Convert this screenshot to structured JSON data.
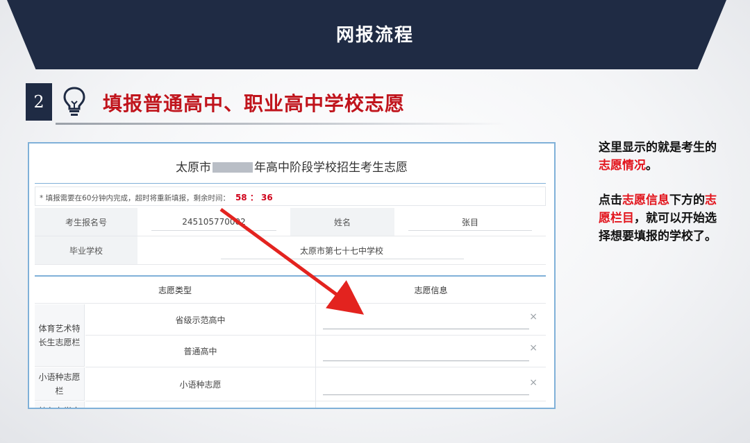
{
  "banner": {
    "title": "网报流程"
  },
  "step": {
    "number": "2",
    "icon": "lightbulb-icon",
    "title": "填报普通高中、职业高中学校志愿"
  },
  "form": {
    "title_prefix": "太原市",
    "title_suffix": "年高中阶段学校招生考生志愿",
    "notice": "* 填报需要在60分钟内完成，超时将重新填报，剩余时间：",
    "timer": "58 ： 36",
    "info": {
      "exam_no_label": "考生报名号",
      "exam_no_value": "245105770002",
      "name_label": "姓名",
      "name_value": "张目",
      "school_label": "毕业学校",
      "school_value": "太原市第七十七中学校"
    },
    "volunteer_table": {
      "header_type": "志愿类型",
      "header_info": "志愿信息",
      "categories": [
        {
          "label": "体育艺术特长生志愿栏",
          "subs": [
            "省级示范高中",
            "普通高中"
          ]
        },
        {
          "label": "小语种志愿栏",
          "subs": [
            "小语种志愿"
          ]
        },
        {
          "label": "特色办学实",
          "subs": [
            ""
          ]
        }
      ],
      "clear_symbol": "×"
    }
  },
  "explanation": {
    "p1_a": "这里显示的就是考生的",
    "p1_red": "志愿情况",
    "p1_b": "。",
    "p2_a": "点击",
    "p2_red1": "志愿信息",
    "p2_b": "下方的",
    "p2_red2": "志愿栏目",
    "p2_c": "，就可以开始选择想要填报的学校了。"
  },
  "colors": {
    "banner": "#1f2b44",
    "accent_red": "#c0141c",
    "panel_border": "#7fb0d8",
    "arrow": "#e3231f"
  }
}
